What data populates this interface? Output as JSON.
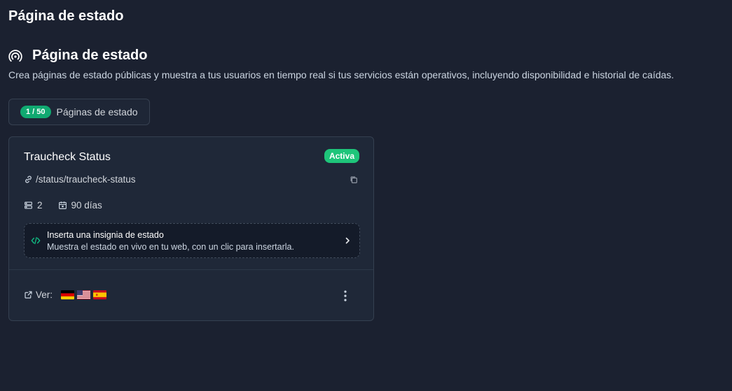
{
  "header": {
    "title": "Página de estado"
  },
  "section": {
    "title": "Página de estado",
    "icon": "broadcast-icon",
    "description": "Crea páginas de estado públicas y muestra a tus usuarios en tiempo real si tus servicios están operativos, incluyendo disponibilidad e historial de caídas."
  },
  "counter": {
    "value": "1 / 50",
    "label": "Páginas de estado"
  },
  "card": {
    "name": "Traucheck Status",
    "status": "Activa",
    "slug": "/status/traucheck-status",
    "monitors": "2",
    "history": "90 días",
    "embed": {
      "title": "Inserta una insignia de estado",
      "subtitle": "Muestra el estado en vivo en tu web, con un clic para insertarla."
    },
    "view_label": "Ver:",
    "languages": [
      "de",
      "en",
      "es"
    ]
  },
  "colors": {
    "background": "#1b2130",
    "card": "#1f2838",
    "accent_green": "#10a971",
    "active_badge": "#1ec57a"
  }
}
